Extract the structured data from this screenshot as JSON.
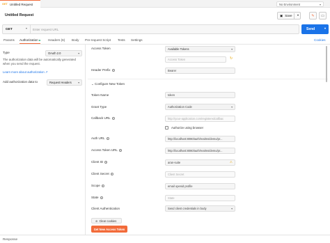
{
  "tab": {
    "method": "GET",
    "title": "Untitled Request"
  },
  "environment": {
    "label": "No Environment"
  },
  "request": {
    "title": "Untitled Request",
    "save_label": "Save"
  },
  "url_bar": {
    "method": "GET",
    "placeholder": "Enter request URL",
    "send_label": "Send"
  },
  "subtabs": [
    {
      "label": "Params"
    },
    {
      "label": "Authorization"
    },
    {
      "label": "Headers (6)"
    },
    {
      "label": "Body"
    },
    {
      "label": "Pre-request Script"
    },
    {
      "label": "Tests"
    },
    {
      "label": "Settings"
    }
  ],
  "cookies_label": "Cookies",
  "left_panel": {
    "type_label": "Type",
    "type_value": "OAuth 2.0",
    "note": "The authorization data will be automatically generated when you send the request.",
    "learn_more": "Learn more about authorization ↗",
    "add_to_label": "Add authorization data to",
    "add_to_value": "Request Headers"
  },
  "form": {
    "access_token_label": "Access Token",
    "access_token_select": "Available Tokens",
    "access_token_field": "Access Token",
    "header_prefix_label": "Header Prefix",
    "header_prefix_value": "Bearer",
    "section_title": "Configure New Token",
    "token_name_label": "Token Name",
    "token_name_value": "token",
    "grant_type_label": "Grant Type",
    "grant_type_value": "Authorization Code",
    "callback_url_label": "Callback URL",
    "callback_url_value": "http://your-application.com/registeredcallbac",
    "authorize_browser_label": "Authorize using browser",
    "auth_url_label": "Auth URL",
    "auth_url_value": "http://localhost:8080/auth/realms/demo/pr...",
    "access_token_url_label": "Access Token URL",
    "access_token_url_value": "http://localhost:8080/auth/realms/demo/pr...",
    "client_id_label": "Client ID",
    "client_id_value": "aran-suite",
    "client_secret_label": "Client Secret",
    "client_secret_placeholder": "Client Secret",
    "scope_label": "Scope",
    "scope_value": "email openid profile",
    "state_label": "State",
    "state_placeholder": "State",
    "client_auth_label": "Client Authentication",
    "client_auth_value": "Send client credentials in body",
    "clear_cookies_label": "Clear cookies",
    "get_token_label": "Get New Access Token"
  },
  "response_label": "Response",
  "colors": {
    "accent": "#f26b3a",
    "primary": "#1a73e8",
    "success": "#26b47f"
  },
  "icons": [
    "chevron-down-icon",
    "save-icon",
    "edit-icon",
    "comment-icon",
    "info-icon",
    "warning-icon",
    "refresh-icon"
  ]
}
